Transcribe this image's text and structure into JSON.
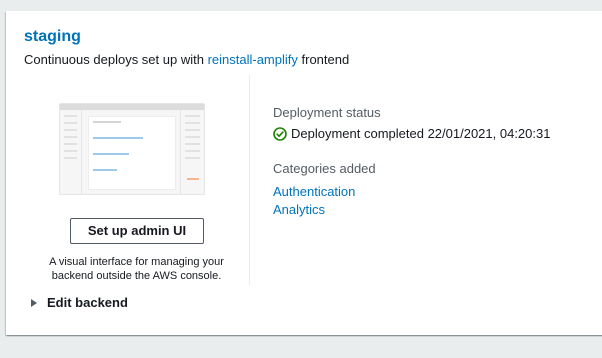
{
  "environment": {
    "name": "staging",
    "subtitle_prefix": "Continuous deploys set up with",
    "app_link": "reinstall-amplify",
    "subtitle_suffix": "frontend"
  },
  "admin_ui": {
    "button_label": "Set up admin UI",
    "description_line1": "A visual interface for managing your",
    "description_line2": "backend outside the AWS console."
  },
  "deployment": {
    "status_label": "Deployment status",
    "status_icon": "check-circle-icon",
    "status_text": "Deployment completed 22/01/2021, 04:20:31",
    "status_color": "#1d8102"
  },
  "categories": {
    "label": "Categories added",
    "items": [
      "Authentication",
      "Analytics"
    ]
  },
  "expander": {
    "label": "Edit backend",
    "icon": "caret-right-icon"
  },
  "colors": {
    "link": "#0073bb",
    "illustration_blue": "#9fc9ea",
    "illustration_orange": "#f4b58f"
  }
}
